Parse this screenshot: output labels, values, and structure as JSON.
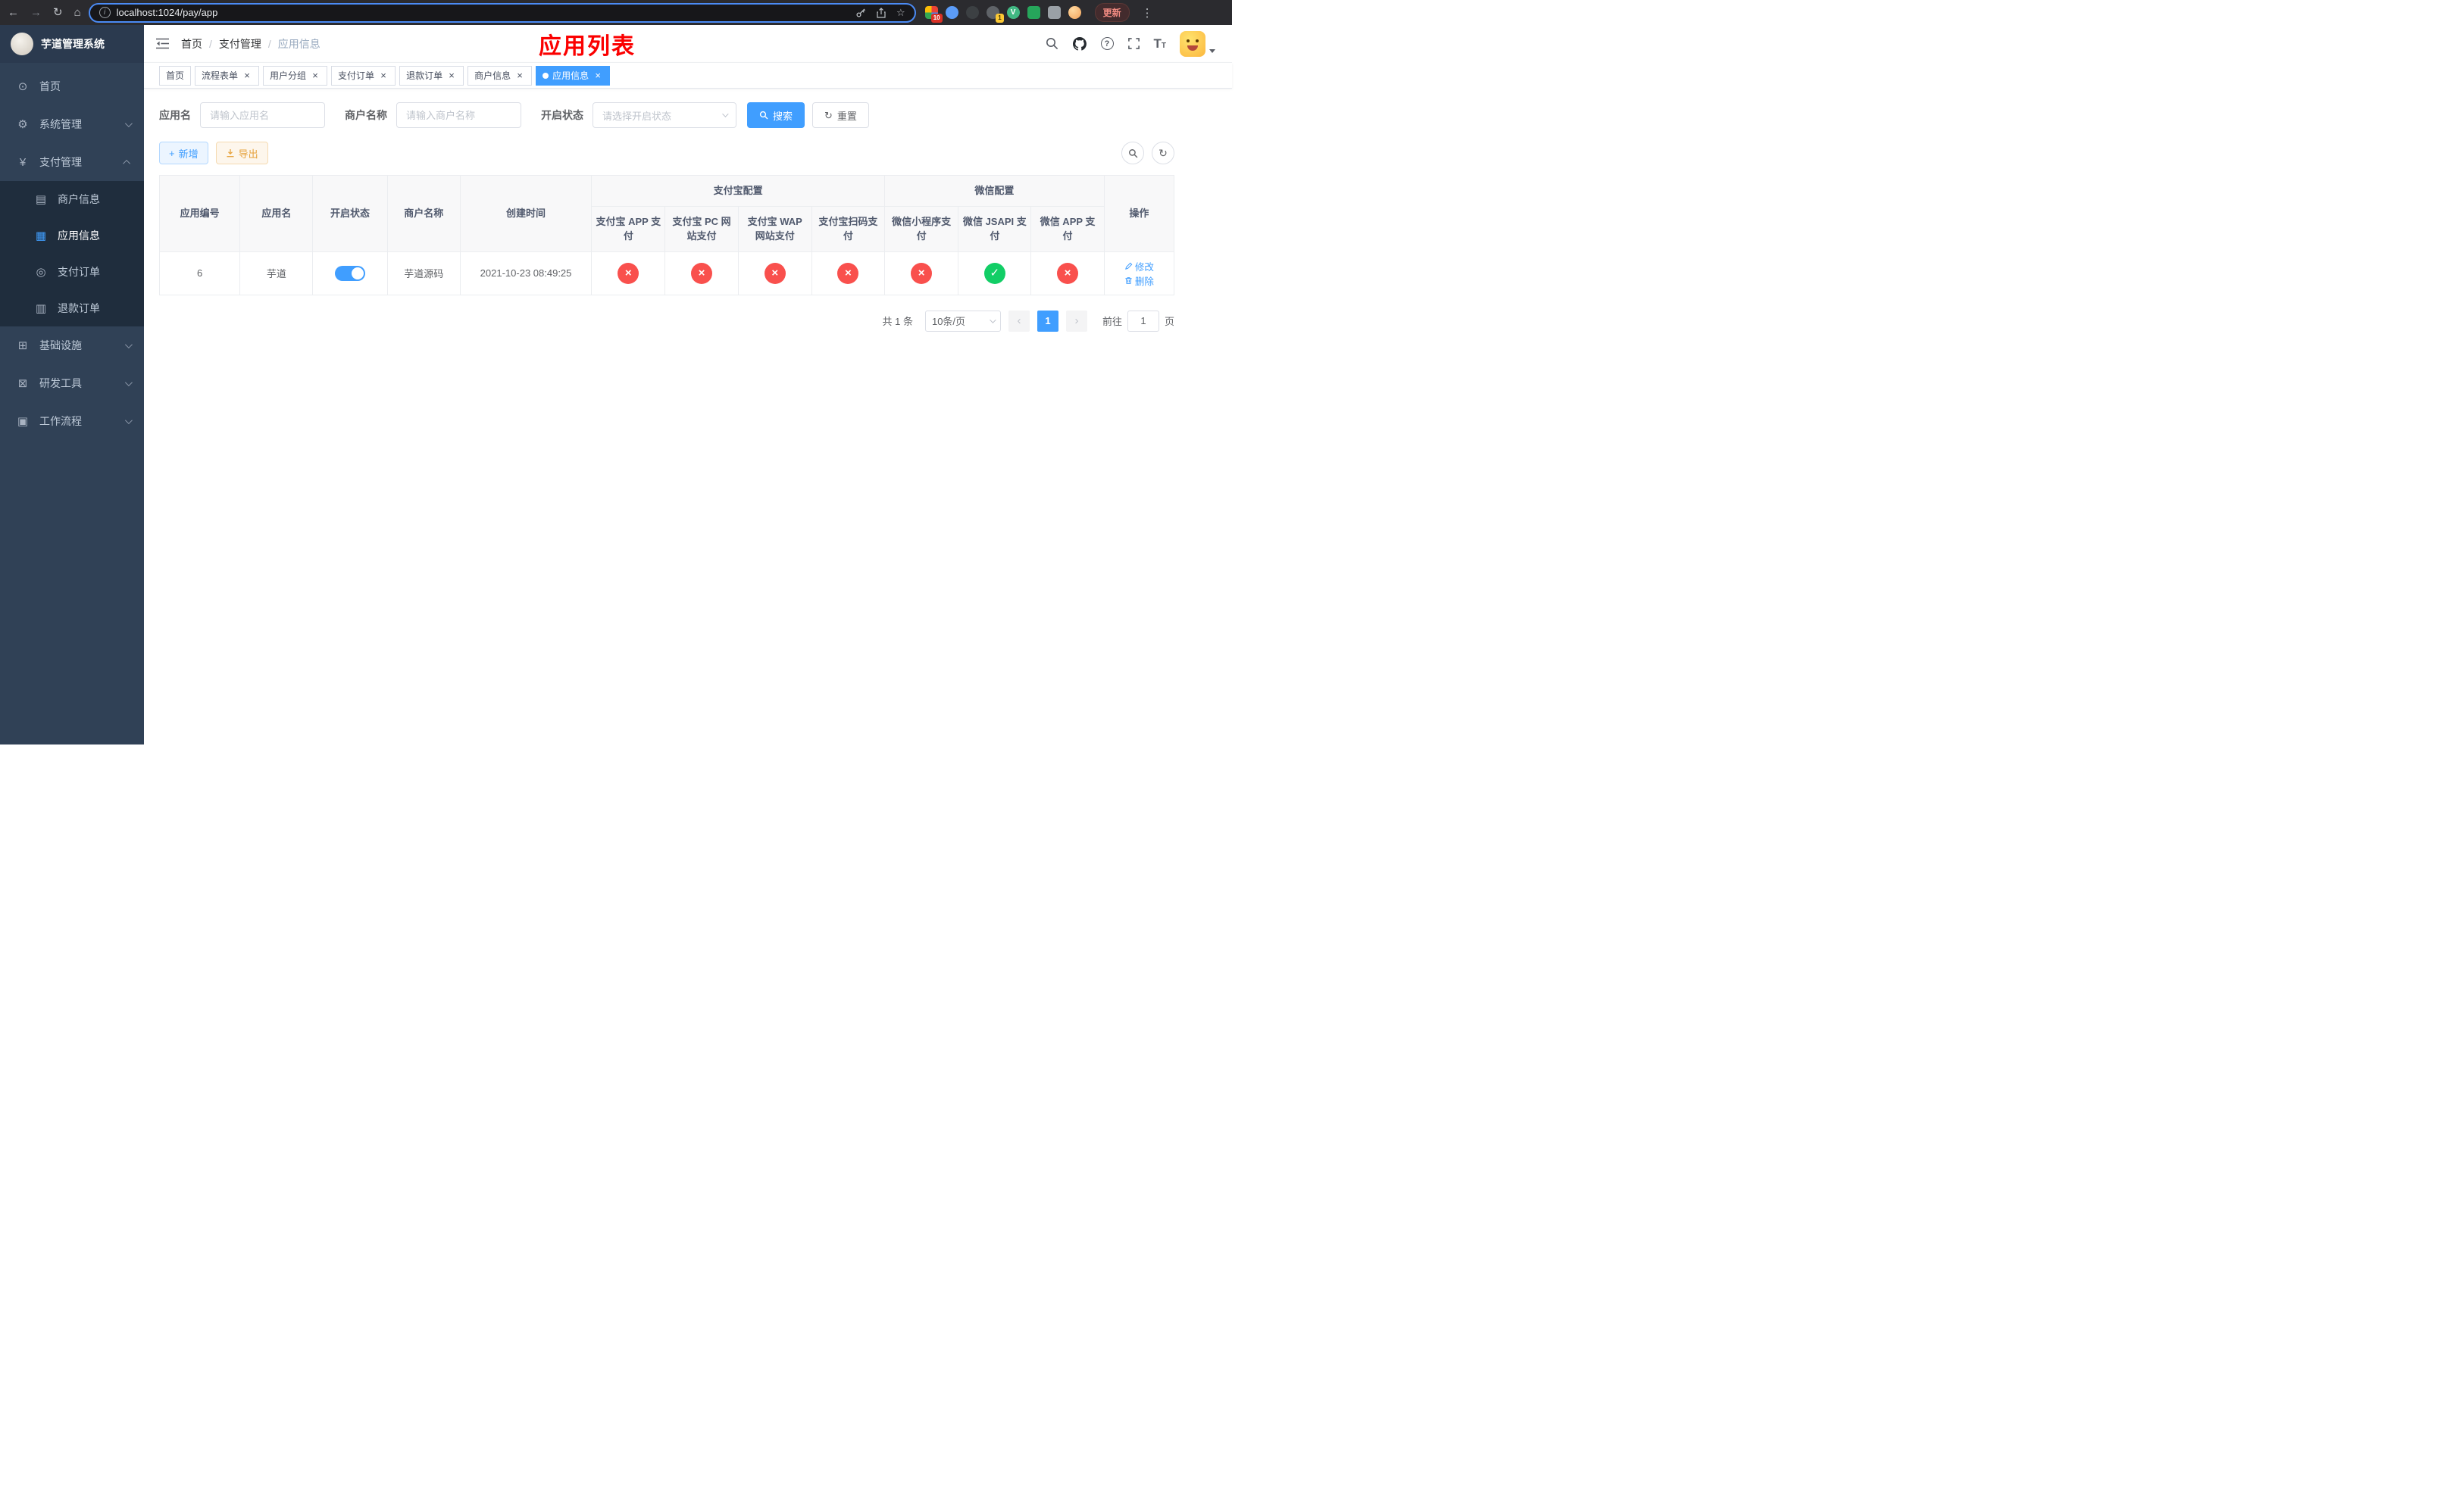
{
  "browser": {
    "url": "localhost:1024/pay/app",
    "update_label": "更新",
    "extension_badges": [
      "10",
      "1"
    ]
  },
  "sidebar": {
    "title": "芋道管理系统",
    "menu": [
      {
        "name": "home",
        "label": "首页",
        "icon": "dashboard-icon",
        "type": "item"
      },
      {
        "name": "system-management",
        "label": "系统管理",
        "icon": "gear-icon",
        "type": "group",
        "expanded": false
      },
      {
        "name": "payment-management",
        "label": "支付管理",
        "icon": "yen-icon",
        "type": "group",
        "expanded": true,
        "children": [
          {
            "name": "merchant-info",
            "label": "商户信息",
            "icon": "bank-card-icon",
            "active": false
          },
          {
            "name": "app-info",
            "label": "应用信息",
            "icon": "grid-icon",
            "active": true
          },
          {
            "name": "payment-order",
            "label": "支付订单",
            "icon": "order-icon",
            "active": false
          },
          {
            "name": "refund-order",
            "label": "退款订单",
            "icon": "refund-icon",
            "active": false
          }
        ]
      },
      {
        "name": "infrastructure",
        "label": "基础设施",
        "icon": "infra-icon",
        "type": "group",
        "expanded": false
      },
      {
        "name": "dev-tools",
        "label": "研发工具",
        "icon": "tools-icon",
        "type": "group",
        "expanded": false
      },
      {
        "name": "workflow",
        "label": "工作流程",
        "icon": "workflow-icon",
        "type": "group",
        "expanded": false
      }
    ]
  },
  "header": {
    "breadcrumb": [
      "首页",
      "支付管理",
      "应用信息"
    ],
    "page_title": "应用列表"
  },
  "tabs": [
    {
      "name": "home",
      "label": "首页",
      "closable": false,
      "active": false
    },
    {
      "name": "process-form",
      "label": "流程表单",
      "closable": true,
      "active": false
    },
    {
      "name": "user-group",
      "label": "用户分组",
      "closable": true,
      "active": false
    },
    {
      "name": "payment-order",
      "label": "支付订单",
      "closable": true,
      "active": false
    },
    {
      "name": "refund-order",
      "label": "退款订单",
      "closable": true,
      "active": false
    },
    {
      "name": "merchant-info",
      "label": "商户信息",
      "closable": true,
      "active": false
    },
    {
      "name": "app-info",
      "label": "应用信息",
      "closable": true,
      "active": true
    }
  ],
  "filters": {
    "app_name_label": "应用名",
    "app_name_placeholder": "请输入应用名",
    "merchant_label": "商户名称",
    "merchant_placeholder": "请输入商户名称",
    "status_label": "开启状态",
    "status_placeholder": "请选择开启状态",
    "search_label": "搜索",
    "reset_label": "重置"
  },
  "toolbar": {
    "add_label": "新增",
    "export_label": "导出"
  },
  "table": {
    "group_alipay": "支付宝配置",
    "group_wechat": "微信配置",
    "col_id": "应用编号",
    "col_name": "应用名",
    "col_status": "开启状态",
    "col_merchant": "商户名称",
    "col_created": "创建时间",
    "col_alipay_app": "支付宝 APP 支付",
    "col_alipay_pc": "支付宝 PC 网站支付",
    "col_alipay_wap": "支付宝 WAP 网站支付",
    "col_alipay_scan": "支付宝扫码支付",
    "col_wx_mini": "微信小程序支付",
    "col_wx_jsapi": "微信 JSAPI 支付",
    "col_wx_app": "微信 APP 支付",
    "col_actions": "操作",
    "rows": [
      {
        "id": "6",
        "name": "芋道",
        "enabled": true,
        "merchant": "芋道源码",
        "created": "2021-10-23 08:49:25",
        "statuses": [
          "closed",
          "closed",
          "closed",
          "closed",
          "closed",
          "open",
          "closed"
        ],
        "edit_label": "修改",
        "delete_label": "删除"
      }
    ]
  },
  "pagination": {
    "total": "共 1 条",
    "page_size": "10条/页",
    "page": "1",
    "goto_label": "前往",
    "goto_value": "1",
    "unit_label": "页"
  },
  "colors": {
    "primary": "#409eff",
    "danger": "#f9504d",
    "success": "#12ce66",
    "title_red": "#fb0000",
    "sidebar_bg": "#304156",
    "submenu_bg": "#1f2d3d"
  }
}
